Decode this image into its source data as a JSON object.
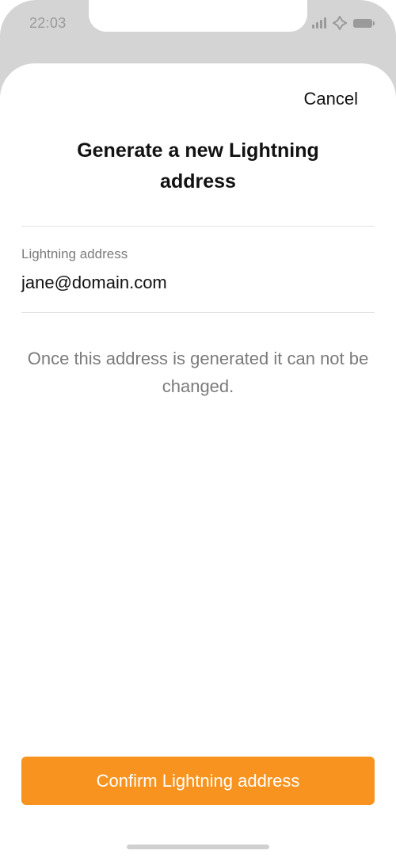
{
  "status_bar": {
    "time": "22:03",
    "icons": [
      "signal-icon",
      "location-icon",
      "battery-icon"
    ],
    "icon_color": "#9a9a9a"
  },
  "header": {
    "cancel_label": "Cancel",
    "title": "Generate a new Lightning address"
  },
  "form": {
    "address_label": "Lightning address",
    "address_value": "jane@domain.com"
  },
  "info": {
    "text": "Once this address is generated it can not be changed."
  },
  "footer": {
    "confirm_label": "Confirm Lightning address"
  },
  "colors": {
    "accent": "#f7931e",
    "background_dim": "#d4d4d4",
    "text_primary": "#111111",
    "text_secondary": "#7b7b7b",
    "divider": "#e3e3e3"
  }
}
